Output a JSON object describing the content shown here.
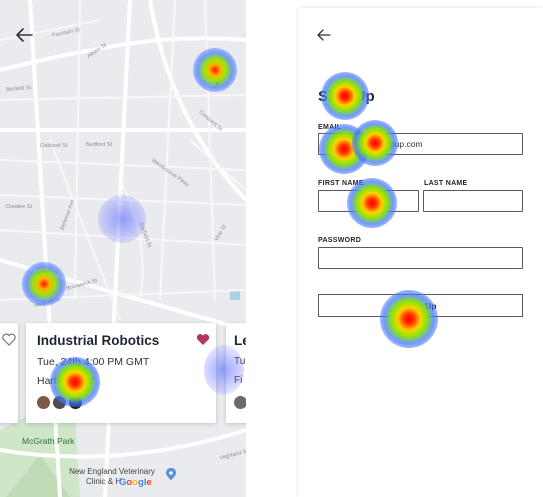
{
  "map_screen": {
    "cards": {
      "main": {
        "title": "Industrial Robotics",
        "date": "Tue, 24th 4:00 PM GMT",
        "location": "Hartford, CT"
      },
      "next": {
        "title_fragment": "Le",
        "date_fragment": "Tu",
        "location_fragment": "Fi"
      }
    },
    "labels": {
      "park": "McGrath Park",
      "vet_line1": "New England Veterinary",
      "vet_line2": "Clinic & H",
      "google": "Google"
    },
    "road_labels": [
      "Fountain St",
      "Albion St",
      "Beckett St",
      "Oakland St",
      "Bedford St",
      "Westbourne Pkwy",
      "Dundee St",
      "Bellevue Ave",
      "Brunswick St",
      "Garfield St",
      "Crescent St",
      "Vine St",
      "Hartford St",
      "Highland St"
    ]
  },
  "signup": {
    "title": "Sign Up",
    "email_label": "EMAIL",
    "email_value": "jane.dean@groupup.com",
    "first_name_label": "FIRST NAME",
    "last_name_label": "LAST NAME",
    "password_label": "PASSWORD",
    "button_label": "Sign Up"
  },
  "colors": {
    "pin_green": "#8bc34a",
    "heart_filled": "#b4365c",
    "card_title": "#1d2733"
  },
  "icons": [
    "back-arrow-icon",
    "map-pin-icon",
    "heart-icon",
    "avatar",
    "location-pin-icon"
  ]
}
